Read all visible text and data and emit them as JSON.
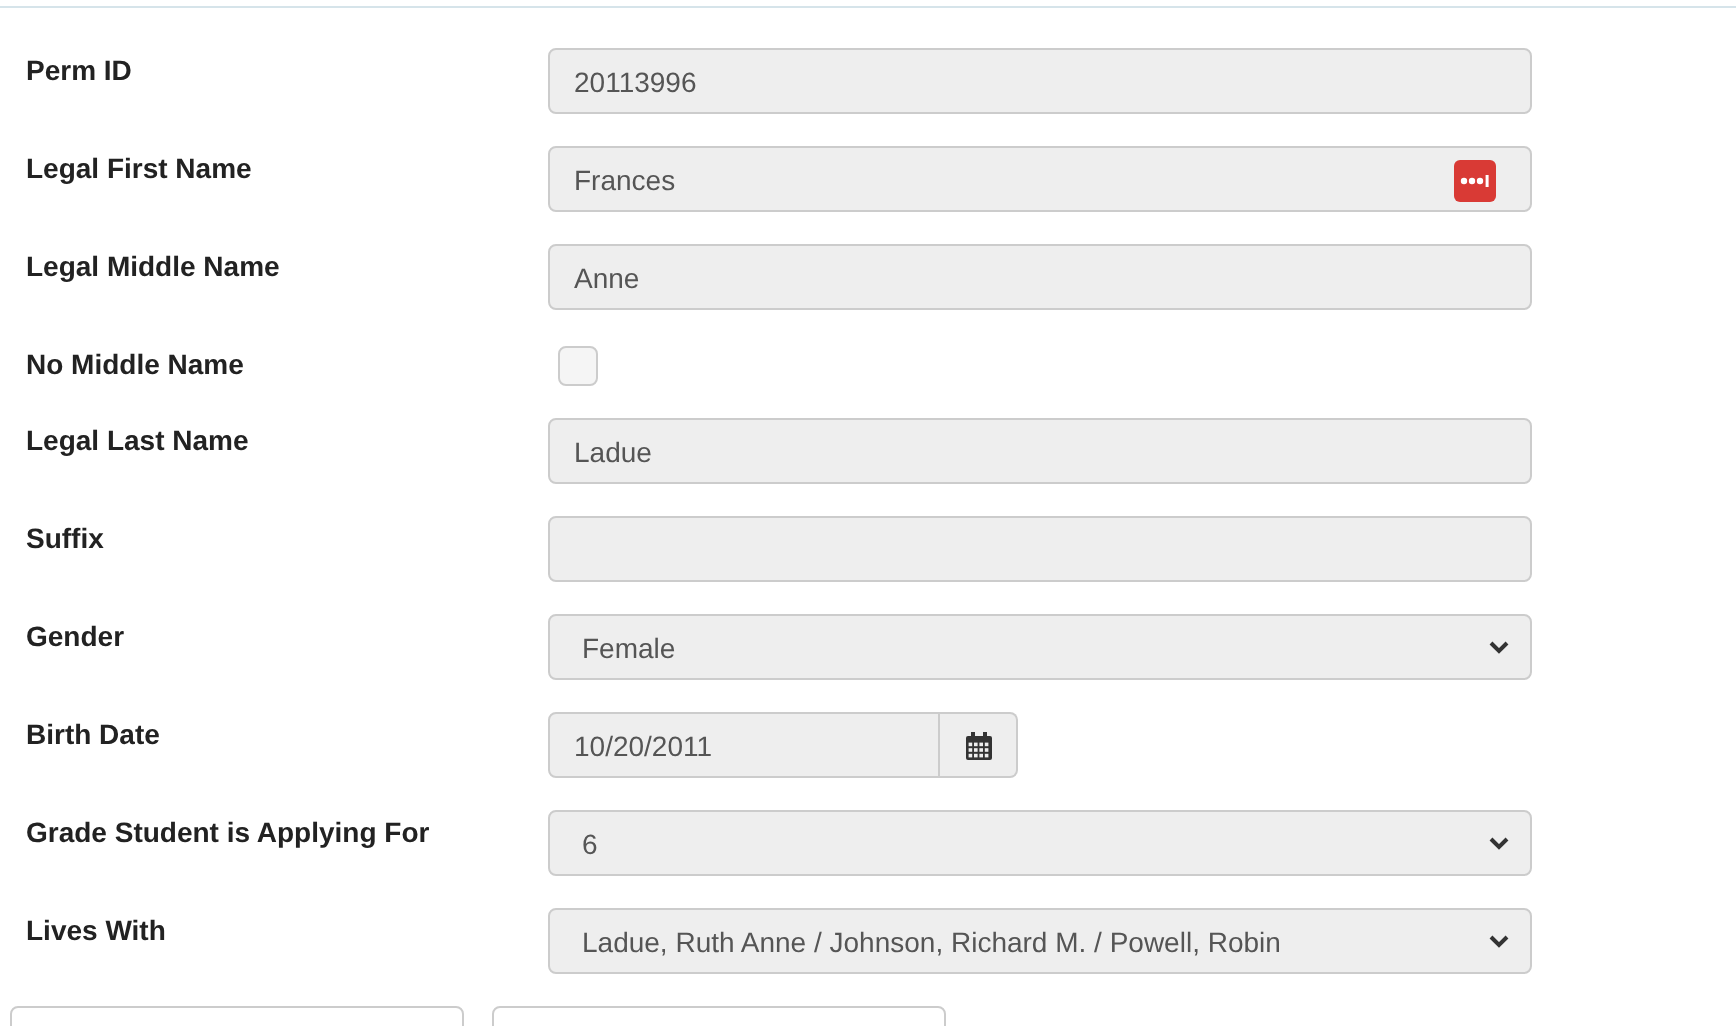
{
  "fields": [
    {
      "kind": "text",
      "label": "Perm ID",
      "value": "20113996"
    },
    {
      "kind": "text_with_badge",
      "label": "Legal First Name",
      "value": "Frances"
    },
    {
      "kind": "text",
      "label": "Legal Middle Name",
      "value": "Anne"
    },
    {
      "kind": "checkbox",
      "label": "No Middle Name",
      "checked": false
    },
    {
      "kind": "text",
      "label": "Legal Last Name",
      "value": "Ladue"
    },
    {
      "kind": "text",
      "label": "Suffix"
    },
    {
      "kind": "select",
      "label": "Gender",
      "value": "Female"
    },
    {
      "kind": "date",
      "label": "Birth Date",
      "value": "10/20/2011"
    },
    {
      "kind": "select",
      "label": "Grade Student is Applying For",
      "value": "6"
    },
    {
      "kind": "select",
      "label": "Lives With",
      "value": "Ladue, Ruth Anne / Johnson, Richard M. / Powell, Robin"
    }
  ]
}
